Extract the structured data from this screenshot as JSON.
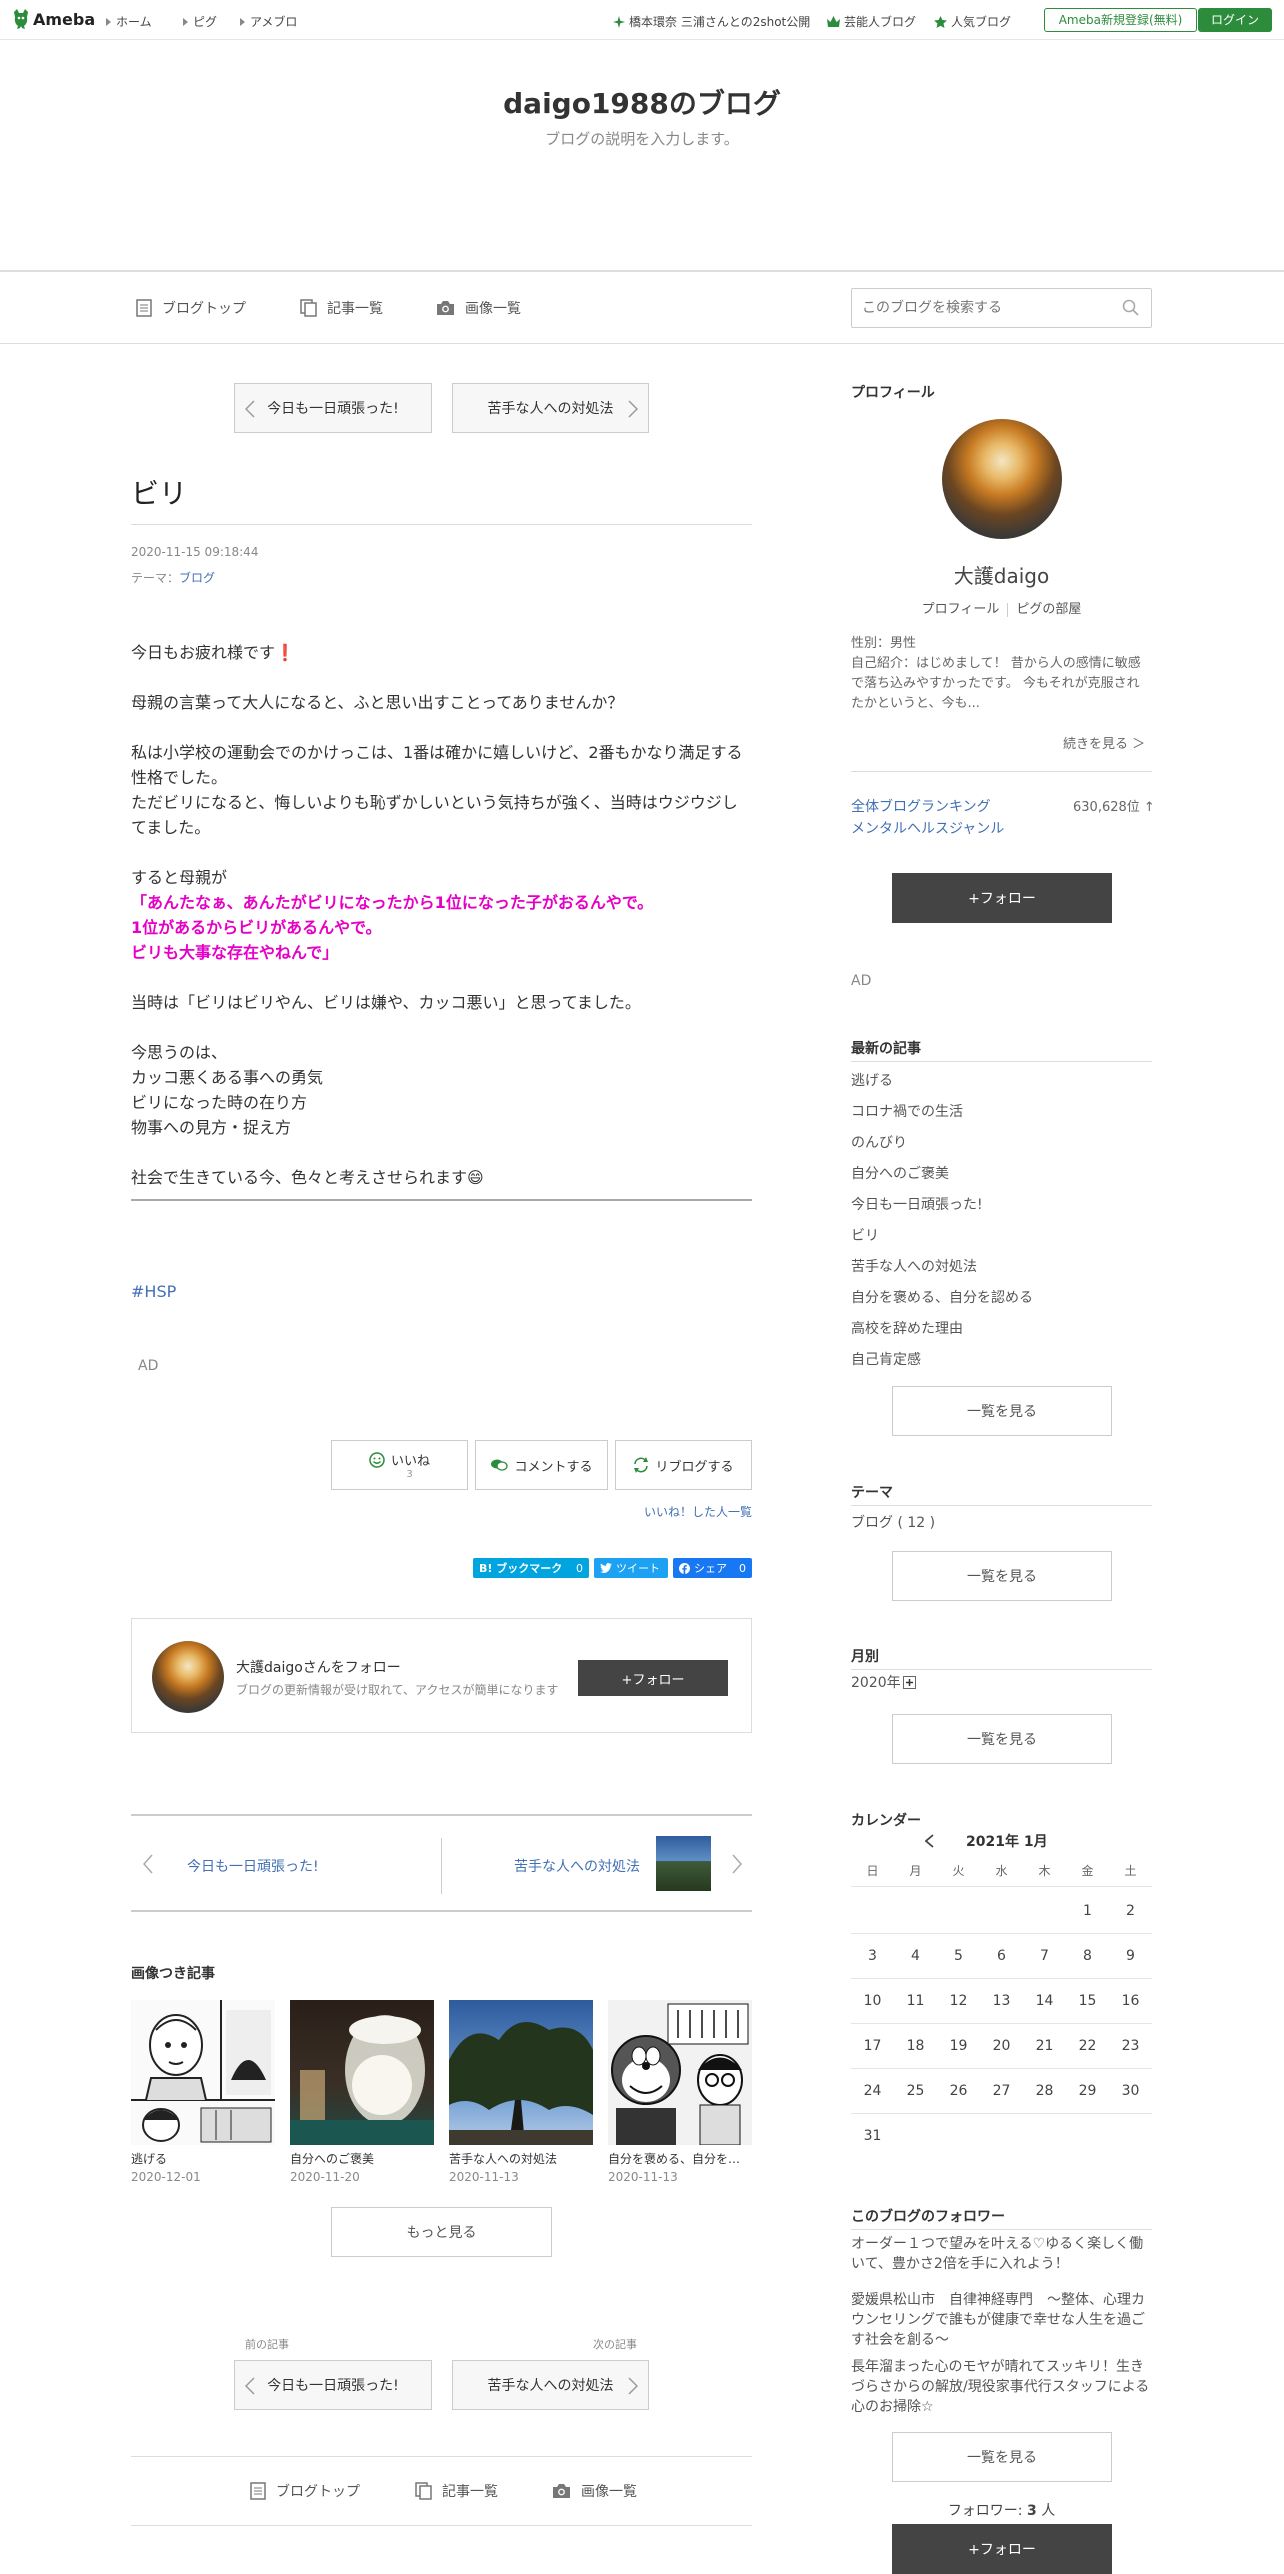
{
  "topbar": {
    "logo": "Ameba",
    "nav": [
      "ホーム",
      "ピグ",
      "アメブロ"
    ],
    "links": [
      "橋本環奈 三浦さんとの2shot公開",
      "芸能人ブログ",
      "人気ブログ"
    ],
    "register": "Ameba新規登録(無料)",
    "login": "ログイン",
    "accent": "#2d8c3c"
  },
  "blog": {
    "title": "daigo1988のブログ",
    "description": "ブログの説明を入力します。"
  },
  "blognav": {
    "items": [
      "ブログトップ",
      "記事一覧",
      "画像一覧"
    ],
    "search_placeholder": "このブログを検索する"
  },
  "pager": {
    "prev": "今日も一日頑張った!",
    "next": "苦手な人への対処法",
    "prev_label": "前の記事",
    "next_label": "次の記事"
  },
  "article": {
    "title": "ビリ",
    "date": "2020-11-15 09:18:44",
    "theme_label": "テーマ：",
    "theme": "ブログ",
    "p1": "今日もお疲れ様です",
    "p1_emoji": "❗",
    "p2": "母親の言葉って大人になると、ふと思い出すことってありませんか？",
    "p3a": "私は小学校の運動会でのかけっこは、1番は確かに嬉しいけど、2番もかなり満足する性格でした。",
    "p3b": "ただビリになると、悔しいよりも恥ずかしいという気持ちが強く、当時はウジウジしてました。",
    "p4": "すると母親が",
    "q1": "「あんたなぁ、あんたがビリになったから1位になった子がおるんやで。",
    "q2": "1位があるからビリがあるんやで。",
    "q3": "ビリも大事な存在やねんで」",
    "p5": "当時は「ビリはビリやん、ビリは嫌や、カッコ悪い」と思ってました。",
    "p6a": "今思うのは、",
    "p6b": "カッコ悪くある事への勇気",
    "p6c": "ビリになった時の在り方",
    "p6d": "物事への見方・捉え方",
    "p7": "社会で生きている今、色々と考えさせられます",
    "p7_emoji": "😄",
    "hashtag": "#HSP",
    "ad": "AD"
  },
  "actions": {
    "like": "いいね",
    "like_count": "3",
    "comment": "コメントする",
    "reblog": "リブログする",
    "like_list": "いいね！した人一覧"
  },
  "share": {
    "hatena": "B! ブックマーク",
    "hatena_count": "0",
    "tweet": "ツイート",
    "facebook": "シェア",
    "facebook_count": "0"
  },
  "follow_card": {
    "name": "大護daigoさんをフォロー",
    "desc": "ブログの更新情報が受け取れて、アクセスが簡単になります",
    "button": "+フォロー"
  },
  "prevnext": {
    "prev": "今日も一日頑張った!",
    "next": "苦手な人への対処法"
  },
  "image_posts": {
    "title": "画像つき記事",
    "items": [
      {
        "title": "逃げる",
        "date": "2020-12-01"
      },
      {
        "title": "自分へのご褒美",
        "date": "2020-11-20"
      },
      {
        "title": "苦手な人への対処法",
        "date": "2020-11-13"
      },
      {
        "title": "自分を褒める、自分を…",
        "date": "2020-11-13"
      }
    ],
    "more": "もっと見る"
  },
  "profile": {
    "heading": "プロフィール",
    "name": "大護daigo",
    "link_profile": "プロフィール",
    "link_room": "ピグの部屋",
    "gender": "性別：男性",
    "intro": "自己紹介：はじめまして！ 昔から人の感情に敏感で落ち込みやすかったです。 今もそれが克服されたかというと、今も...",
    "more": "続きを見る ＞",
    "rank_all": "全体ブログランキング",
    "rank_genre": "メンタルヘルスジャンル",
    "rank_value": "630,628位 ↑",
    "follow": "+フォロー",
    "ad": "AD"
  },
  "recent": {
    "heading": "最新の記事",
    "items": [
      "逃げる",
      "コロナ禍での生活",
      "のんびり",
      "自分へのご褒美",
      "今日も一日頑張った!",
      "ビリ",
      "苦手な人への対処法",
      "自分を褒める、自分を認める",
      "高校を辞めた理由",
      "自己肯定感"
    ],
    "more": "一覧を見る"
  },
  "themes": {
    "heading": "テーマ",
    "items": [
      "ブログ ( 12 )"
    ],
    "more": "一覧を見る"
  },
  "monthly": {
    "heading": "月別",
    "year": "2020年",
    "more": "一覧を見る"
  },
  "calendar": {
    "heading": "カレンダー",
    "month": "2021年 1月",
    "weekdays": [
      "日",
      "月",
      "火",
      "水",
      "木",
      "金",
      "土"
    ],
    "weeks": [
      [
        "",
        "",
        "",
        "",
        "",
        "1",
        "2"
      ],
      [
        "3",
        "4",
        "5",
        "6",
        "7",
        "8",
        "9"
      ],
      [
        "10",
        "11",
        "12",
        "13",
        "14",
        "15",
        "16"
      ],
      [
        "17",
        "18",
        "19",
        "20",
        "21",
        "22",
        "23"
      ],
      [
        "24",
        "25",
        "26",
        "27",
        "28",
        "29",
        "30"
      ],
      [
        "31",
        "",
        "",
        "",
        "",
        "",
        ""
      ]
    ]
  },
  "followers": {
    "heading": "このブログのフォロワー",
    "items": [
      "オーダー１つで望みを叶える♡ゆるく楽しく働いて、豊かさ2倍を手に入れよう！",
      "愛媛県松山市　自律神経専門　〜整体、心理カウンセリングで誰もが健康で幸せな人生を過ごす社会を創る〜",
      "長年溜まった心のモヤが晴れてスッキリ！生きづらさからの解放/現役家事代行スタッフによる心のお掃除☆"
    ],
    "more": "一覧を見る",
    "count_label": "フォロワー:",
    "count": "3",
    "count_unit": "人",
    "follow": "+フォロー"
  }
}
